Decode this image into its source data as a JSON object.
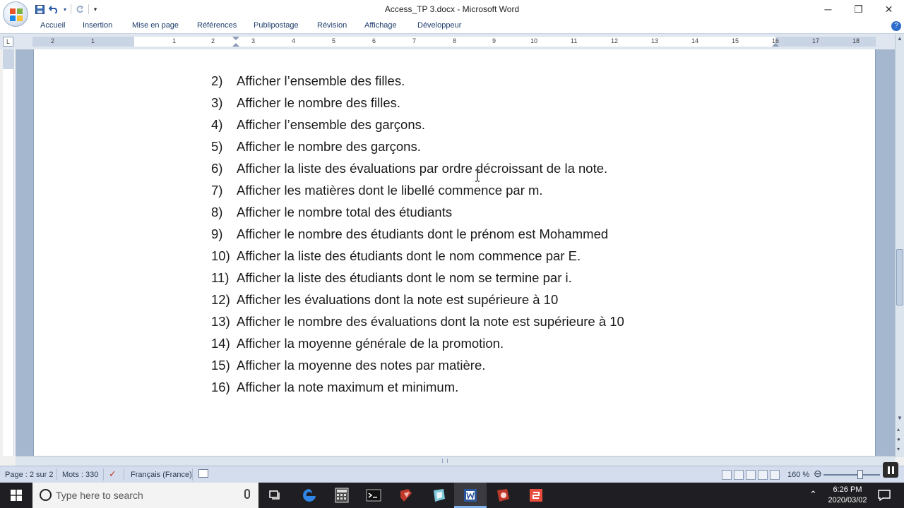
{
  "window": {
    "title": "Access_TP 3.docx - Microsoft Word",
    "controls": {
      "minimize": "─",
      "restore": "❐",
      "close": "✕"
    }
  },
  "quick_access": {
    "customize": "▾"
  },
  "ribbon": {
    "tabs": [
      "Accueil",
      "Insertion",
      "Mise en page",
      "Références",
      "Publipostage",
      "Révision",
      "Affichage",
      "Développeur"
    ]
  },
  "ruler": {
    "tab_selector": "L",
    "numbers": [
      "2",
      "1",
      "1",
      "2",
      "3",
      "4",
      "5",
      "6",
      "7",
      "8",
      "9",
      "10",
      "11",
      "12",
      "13",
      "14",
      "15",
      "16",
      "17",
      "18"
    ]
  },
  "document": {
    "items": [
      {
        "num": "2)",
        "text": "Afficher l’ensemble des filles."
      },
      {
        "num": "3)",
        "text": "Afficher le nombre des filles."
      },
      {
        "num": "4)",
        "text": "Afficher l’ensemble des garçons."
      },
      {
        "num": "5)",
        "text": "Afficher le nombre des garçons."
      },
      {
        "num": "6)",
        "text": "Afficher la liste des évaluations par ordre décroissant de la note."
      },
      {
        "num": "7)",
        "text": "Afficher les matières dont le libellé commence par m."
      },
      {
        "num": "8)",
        "text": "Afficher le nombre total des étudiants"
      },
      {
        "num": "9)",
        "text": "Afficher le nombre des étudiants dont le prénom est Mohammed"
      },
      {
        "num": "10)",
        "text": "Afficher la liste des étudiants dont le nom commence par E."
      },
      {
        "num": "11)",
        "text": "Afficher la liste des étudiants dont le nom se termine par i."
      },
      {
        "num": "12)",
        "text": "Afficher les évaluations dont la note est supérieure à 10"
      },
      {
        "num": "13)",
        "text": "Afficher le nombre des évaluations dont la note est supérieure à 10"
      },
      {
        "num": "14)",
        "text": "Afficher la moyenne générale de la promotion."
      },
      {
        "num": "15)",
        "text": "Afficher la moyenne des notes par matière."
      },
      {
        "num": "16)",
        "text": "Afficher la note maximum et minimum."
      }
    ]
  },
  "statusbar": {
    "page": "Page : 2 sur 2",
    "words": "Mots : 330",
    "language": "Français (France)",
    "zoom": "160 %"
  },
  "taskbar": {
    "search_placeholder": "Type here to search",
    "time": "6:26 PM",
    "date": "2020/03/02"
  },
  "colors": {
    "ribbon_text": "#1e3d6b",
    "doc_background": "#a5b7ce",
    "statusbar": "#d3dded",
    "taskbar": "#1f1f23"
  }
}
